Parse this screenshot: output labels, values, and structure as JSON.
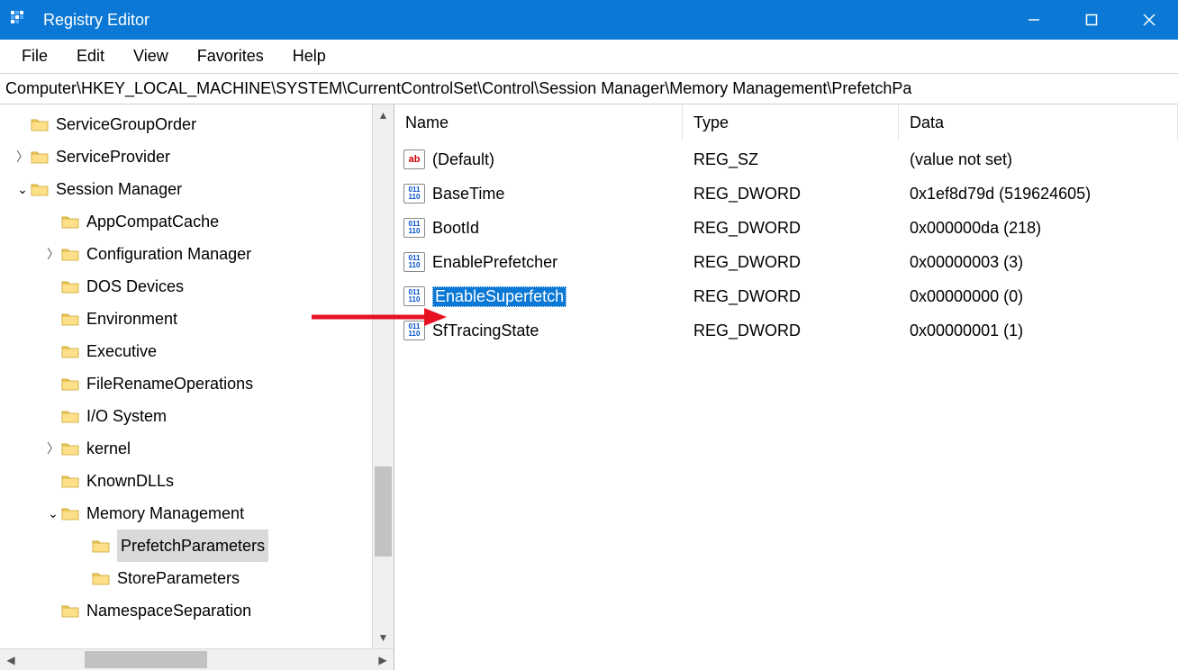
{
  "window": {
    "title": "Registry Editor"
  },
  "menu": {
    "file": "File",
    "edit": "Edit",
    "view": "View",
    "favorites": "Favorites",
    "help": "Help"
  },
  "address": "Computer\\HKEY_LOCAL_MACHINE\\SYSTEM\\CurrentControlSet\\Control\\Session Manager\\Memory Management\\PrefetchPa",
  "tree": {
    "items": [
      {
        "indent": 1,
        "expander": "",
        "label": "ServiceGroupOrder"
      },
      {
        "indent": 1,
        "expander": ">",
        "label": "ServiceProvider"
      },
      {
        "indent": 1,
        "expander": "v",
        "label": "Session Manager"
      },
      {
        "indent": 2,
        "expander": "",
        "label": "AppCompatCache"
      },
      {
        "indent": 2,
        "expander": ">",
        "label": "Configuration Manager"
      },
      {
        "indent": 2,
        "expander": "",
        "label": "DOS Devices"
      },
      {
        "indent": 2,
        "expander": "",
        "label": "Environment"
      },
      {
        "indent": 2,
        "expander": "",
        "label": "Executive"
      },
      {
        "indent": 2,
        "expander": "",
        "label": "FileRenameOperations"
      },
      {
        "indent": 2,
        "expander": "",
        "label": "I/O System"
      },
      {
        "indent": 2,
        "expander": ">",
        "label": "kernel"
      },
      {
        "indent": 2,
        "expander": "",
        "label": "KnownDLLs"
      },
      {
        "indent": 2,
        "expander": "v",
        "label": "Memory Management"
      },
      {
        "indent": 3,
        "expander": "",
        "label": "PrefetchParameters",
        "selected": true
      },
      {
        "indent": 3,
        "expander": "",
        "label": "StoreParameters"
      },
      {
        "indent": 2,
        "expander": "",
        "label": "NamespaceSeparation"
      }
    ]
  },
  "list": {
    "headers": {
      "name": "Name",
      "type": "Type",
      "data": "Data"
    },
    "rows": [
      {
        "icon": "str",
        "name": "(Default)",
        "type": "REG_SZ",
        "data": "(value not set)"
      },
      {
        "icon": "bin",
        "name": "BaseTime",
        "type": "REG_DWORD",
        "data": "0x1ef8d79d (519624605)"
      },
      {
        "icon": "bin",
        "name": "BootId",
        "type": "REG_DWORD",
        "data": "0x000000da (218)"
      },
      {
        "icon": "bin",
        "name": "EnablePrefetcher",
        "type": "REG_DWORD",
        "data": "0x00000003 (3)"
      },
      {
        "icon": "bin",
        "name": "EnableSuperfetch",
        "type": "REG_DWORD",
        "data": "0x00000000 (0)",
        "selected": true
      },
      {
        "icon": "bin",
        "name": "SfTracingState",
        "type": "REG_DWORD",
        "data": "0x00000001 (1)"
      }
    ]
  }
}
